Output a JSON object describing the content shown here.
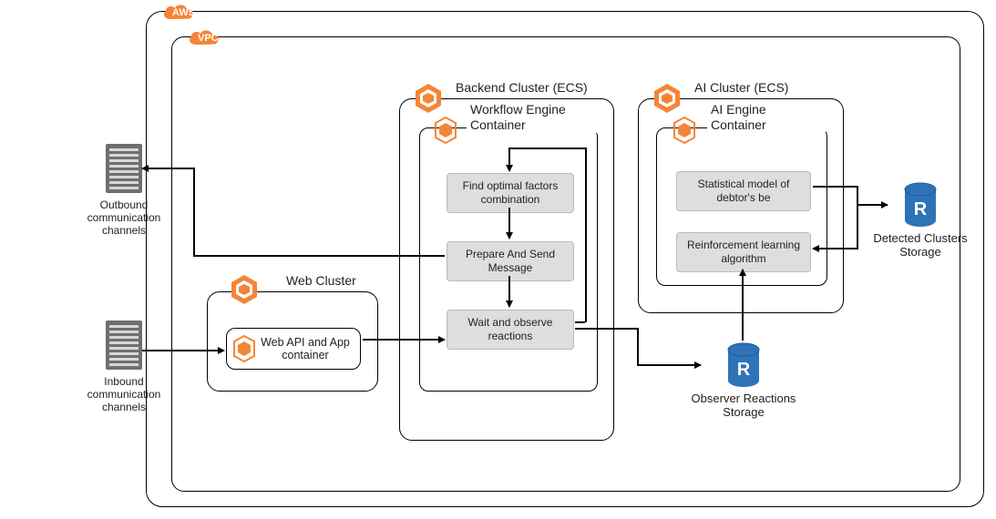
{
  "badges": {
    "aws": "AWS",
    "vpc": "VPC"
  },
  "external": {
    "outbound": "Outbound communication channels",
    "inbound": "Inbound communication channels"
  },
  "clusters": {
    "web": {
      "title": "Web Cluster",
      "container": "Web API and App container"
    },
    "backend": {
      "title": "Backend Cluster (ECS)",
      "engine_title": "Workflow Engine Container",
      "steps": {
        "find": "Find optimal factors combination",
        "prepare": "Prepare And Send Message",
        "wait": "Wait and observe reactions"
      }
    },
    "ai": {
      "title": "AI Cluster (ECS)",
      "engine_title": "AI Engine Container",
      "stats": "Statistical model of debtor's be",
      "rl": "Reinforcement learning algorithm"
    }
  },
  "storage": {
    "observer": "Observer Reactions Storage",
    "detected": "Detected Clusters Storage"
  },
  "colors": {
    "aws_orange": "#F58536",
    "db_blue": "#2E73B8",
    "server_gray": "#6F6F6F",
    "card_gray": "#dedede"
  }
}
